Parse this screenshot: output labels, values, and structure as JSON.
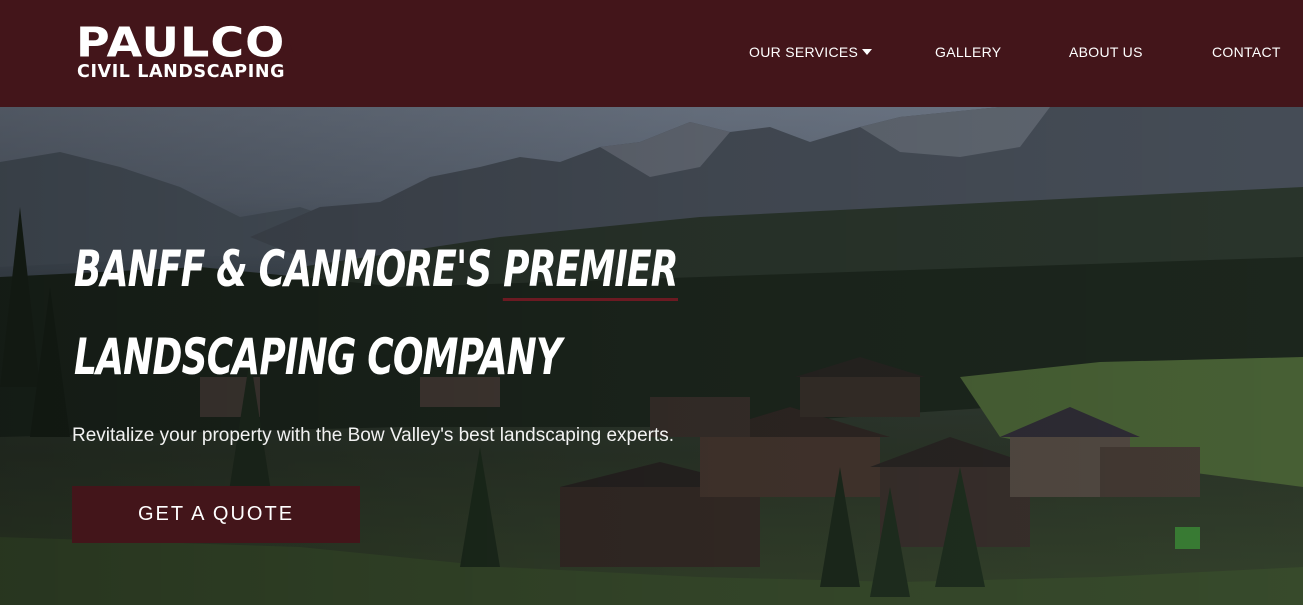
{
  "brand": {
    "logo_top": "PAULCO",
    "logo_bottom": "CIVIL LANDSCAPING"
  },
  "nav": {
    "items": [
      {
        "label": "OUR SERVICES",
        "has_dropdown": true
      },
      {
        "label": "GALLERY"
      },
      {
        "label": "ABOUT US"
      },
      {
        "label": "CONTACT"
      }
    ]
  },
  "hero": {
    "headline_line1_a": "BANFF & CANMORE'S ",
    "headline_line1_b": "PREMIER",
    "headline_line2": "LANDSCAPING COMPANY",
    "subheadline": "Revitalize your property with the Bow Valley's best landscaping experts.",
    "cta_label": "GET A QUOTE",
    "background_image": "mountain-valley-houses-photo"
  },
  "colors": {
    "brand_maroon": "#43151a",
    "text_white": "#ffffff",
    "underline_accent": "#6b1a22"
  }
}
